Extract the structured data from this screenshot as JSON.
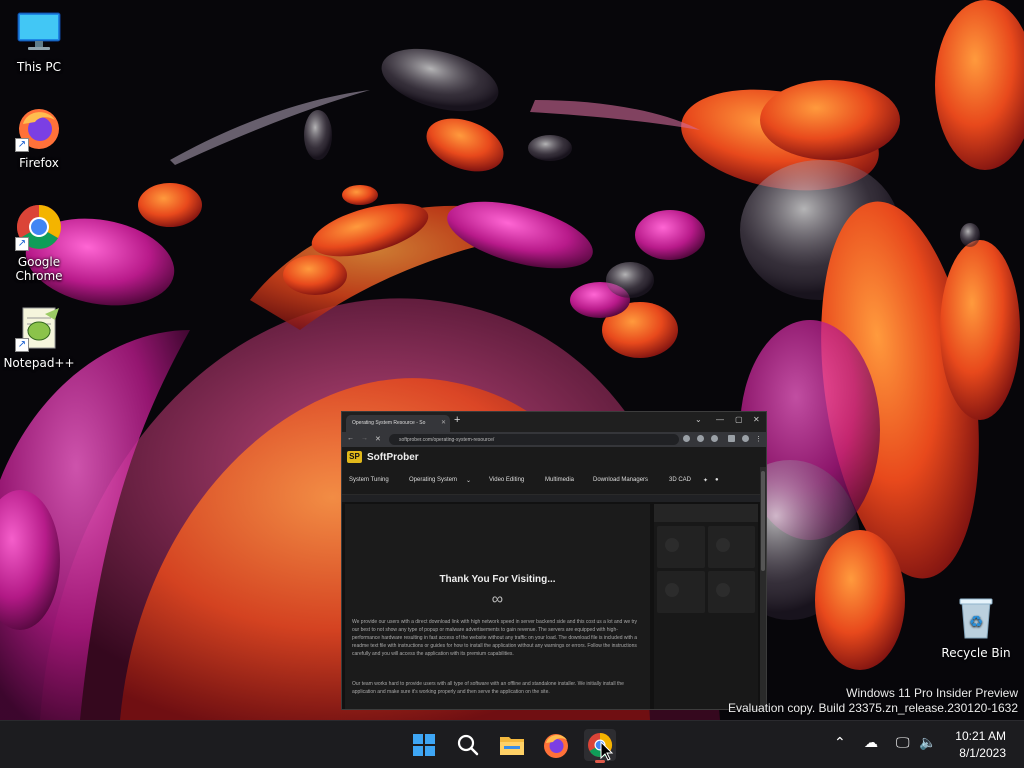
{
  "desktop": {
    "icons": [
      {
        "label": "This PC",
        "icon": "computer-icon"
      },
      {
        "label": "Firefox",
        "icon": "firefox-icon"
      },
      {
        "label": "Google Chrome",
        "icon": "chrome-icon"
      },
      {
        "label": "Notepad++",
        "icon": "notepad-plus-plus-icon"
      }
    ],
    "recycle_bin": {
      "label": "Recycle Bin",
      "icon": "recycle-bin-icon"
    }
  },
  "watermark": {
    "line1": "Windows 11 Pro Insider Preview",
    "line2": "Evaluation copy. Build 23375.zn_release.230120-1632"
  },
  "browser": {
    "tab_title": "Operating System Resource - So",
    "new_tab": "+",
    "url": "softprober.com/operating-system-resource/",
    "site": {
      "logo_text": "SP",
      "name": "SoftProber",
      "nav": [
        "System Tuning",
        "Operating System",
        "Video Editing",
        "Multimedia",
        "Download Managers",
        "3D CAD"
      ],
      "heading": "Thank You For Visiting...",
      "infinity": "∞",
      "paragraph1": "We provide our users with a direct download link with high network speed in server backend side and this cost us a lot and we try our best to not show any type of popup or malware advertisements to gain revenue. The servers are equipped with high-performance hardware resulting in fast access of the website without any traffic on your load. The download file is included with a readme text file with instructions or guides for how to install the application without any warnings or errors. Follow the instructions carefully and you will access the application with its premium capabilities.",
      "paragraph2": "Our team works hard to provide users with all type of software with an offline and standalone installer. We initially install the application and make sure it's working properly and then serve the application on the site."
    }
  },
  "taskbar": {
    "apps": [
      "start-icon",
      "search-icon",
      "file-explorer-icon",
      "firefox-icon",
      "chrome-icon"
    ],
    "tray": [
      "chevron-up-icon",
      "cloud-off-icon",
      "network-icon",
      "volume-icon"
    ],
    "time": "10:21 AM",
    "date": "8/1/2023"
  },
  "colors": {
    "taskbar": "#1c1c1f",
    "browser_bg": "#202124",
    "brand_yellow": "#e1b81b"
  }
}
